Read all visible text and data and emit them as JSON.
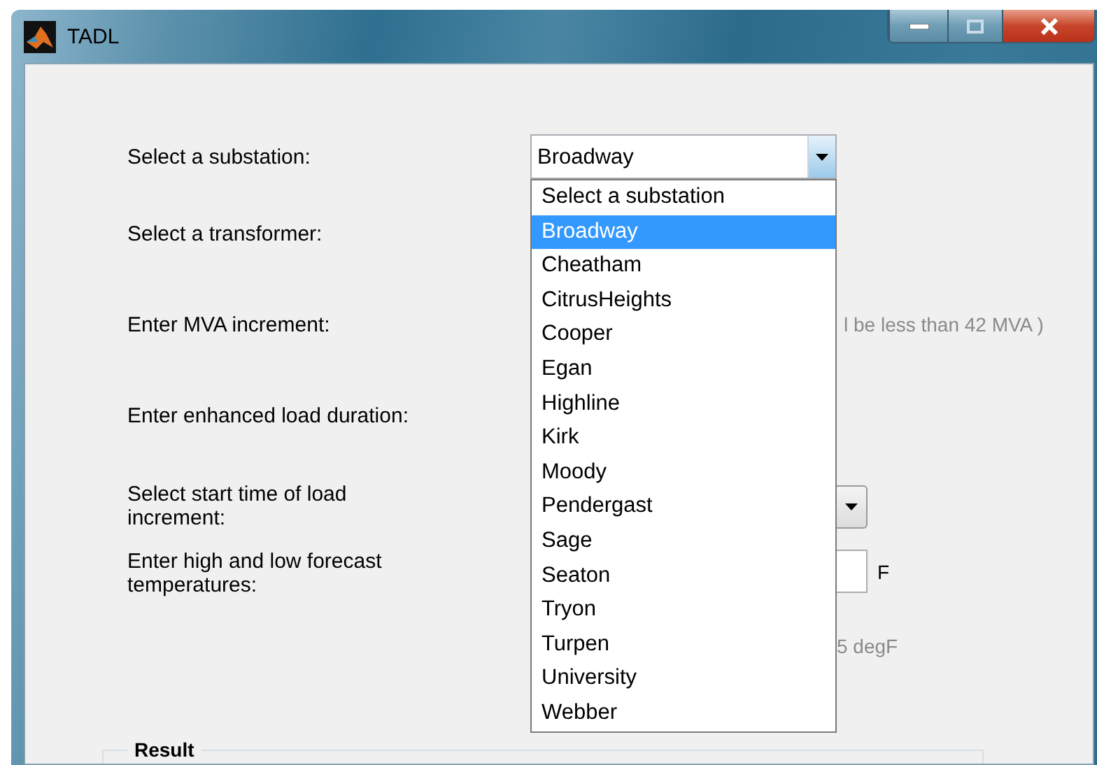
{
  "window": {
    "title": "TADL"
  },
  "form": {
    "substation": {
      "label": "Select a substation:",
      "value": "Broadway",
      "open": true,
      "options": [
        {
          "label": "Select a substation",
          "selected": false
        },
        {
          "label": "Broadway",
          "selected": true
        },
        {
          "label": "Cheatham",
          "selected": false
        },
        {
          "label": "CitrusHeights",
          "selected": false
        },
        {
          "label": "Cooper",
          "selected": false
        },
        {
          "label": "Egan",
          "selected": false
        },
        {
          "label": "Highline",
          "selected": false
        },
        {
          "label": "Kirk",
          "selected": false
        },
        {
          "label": "Moody",
          "selected": false
        },
        {
          "label": "Pendergast",
          "selected": false
        },
        {
          "label": "Sage",
          "selected": false
        },
        {
          "label": "Seaton",
          "selected": false
        },
        {
          "label": "Tryon",
          "selected": false
        },
        {
          "label": "Turpen",
          "selected": false
        },
        {
          "label": "University",
          "selected": false
        },
        {
          "label": "Webber",
          "selected": false
        }
      ]
    },
    "transformer": {
      "label": "Select a transformer:"
    },
    "mva": {
      "label": "Enter MVA increment:",
      "hint": "l be less than 42 MVA )"
    },
    "duration": {
      "label": "Enter enhanced load duration:"
    },
    "start_time": {
      "label": "Select start time of load increment:"
    },
    "temperatures": {
      "label": "Enter high and low forecast temperatures:",
      "unit": "F",
      "hint": "5 degF"
    }
  },
  "result": {
    "title": "Result"
  }
}
